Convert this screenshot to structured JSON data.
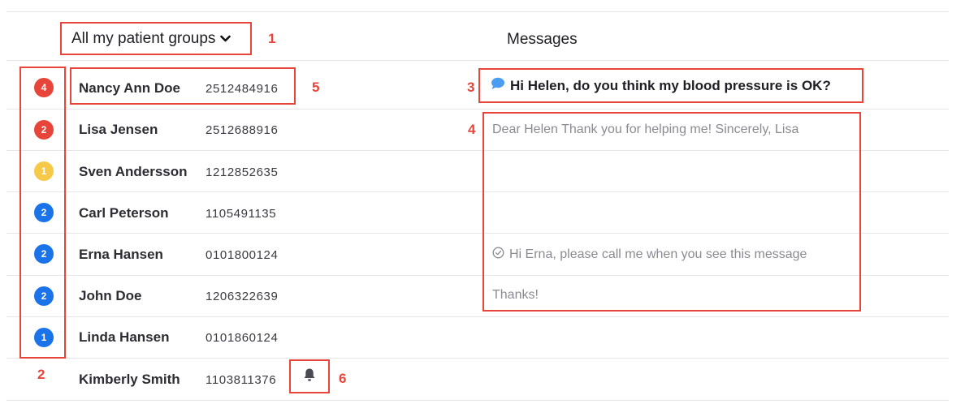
{
  "header": {
    "group_select_label": "All my patient groups",
    "messages_title": "Messages"
  },
  "callouts": [
    "1",
    "2",
    "3",
    "4",
    "5",
    "6"
  ],
  "colors": {
    "annotation": "#e8453a",
    "badge_red": "#e8453a",
    "badge_yellow": "#f7c948",
    "badge_blue": "#1a73e8",
    "bubble_icon": "#4a9df0"
  },
  "patients": [
    {
      "name": "Nancy Ann Doe",
      "id": "2512484916",
      "badge": "4",
      "badge_color": "red"
    },
    {
      "name": "Lisa Jensen",
      "id": "2512688916",
      "badge": "2",
      "badge_color": "red"
    },
    {
      "name": "Sven Andersson",
      "id": "1212852635",
      "badge": "1",
      "badge_color": "yellow"
    },
    {
      "name": "Carl Peterson",
      "id": "1105491135",
      "badge": "2",
      "badge_color": "blue"
    },
    {
      "name": "Erna Hansen",
      "id": "0101800124",
      "badge": "2",
      "badge_color": "blue"
    },
    {
      "name": "John Doe",
      "id": "1206322639",
      "badge": "2",
      "badge_color": "blue"
    },
    {
      "name": "Linda Hansen",
      "id": "0101860124",
      "badge": "1",
      "badge_color": "blue"
    },
    {
      "name": "Kimberly Smith",
      "id": "1103811376",
      "badge": "",
      "badge_color": ""
    }
  ],
  "messages": {
    "unread": "Hi Helen, do you think my blood pressure is OK?",
    "lisa": "Dear Helen Thank you for helping me! Sincerely, Lisa",
    "erna": "Hi Erna, please call me when you see this message",
    "john": "Thanks!"
  },
  "icons": {
    "select_chevron": "chevron-down-icon",
    "bubble": "chat-bubble-icon",
    "read_check": "check-circle-icon",
    "bell": "bell-icon"
  }
}
